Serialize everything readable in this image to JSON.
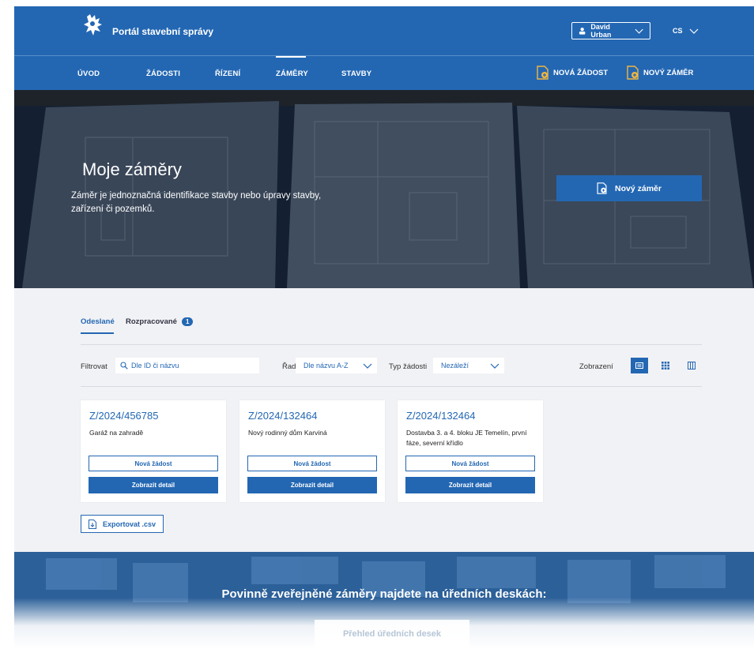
{
  "header": {
    "portal_title": "Portál stavební správy",
    "user_name": "David Urban",
    "language": "CS"
  },
  "nav": {
    "items": [
      "ÚVOD",
      "ŽÁDOSTI",
      "ŘÍZENÍ",
      "ZÁMĚRY",
      "STAVBY"
    ],
    "active": "ZÁMĚRY",
    "new_request": "NOVÁ ŽÁDOST",
    "new_intent": "NOVÝ ZÁMĚR"
  },
  "hero": {
    "title": "Moje záměry",
    "description": "Záměr je jednoznačná identifikace stavby nebo úpravy stavby, zařízení či pozemků.",
    "button": "Nový záměr"
  },
  "tabs": {
    "sent": "Odeslané",
    "drafts": "Rozpracované",
    "drafts_count": "1"
  },
  "filters": {
    "filter_label": "Filtrovat",
    "search_placeholder": "Dle ID či názvu",
    "sort_label": "Řadit",
    "sort_value": "Dle názvu A-Z",
    "type_label": "Typ žádosti",
    "type_value": "Nezáleží",
    "view_label": "Zobrazení"
  },
  "cards": [
    {
      "id": "Z/2024/456785",
      "description": "Garáž na zahradě",
      "btn_new": "Nová žádost",
      "btn_detail": "Zobrazit detail"
    },
    {
      "id": "Z/2024/132464",
      "description": "Nový rodinný dům Karviná",
      "btn_new": "Nová žádost",
      "btn_detail": "Zobrazit detail"
    },
    {
      "id": "Z/2024/132464",
      "description": "Dostavba 3. a 4. bloku JE Temelín, první fáze, severní křídlo",
      "btn_new": "Nová žádost",
      "btn_detail": "Zobrazit detail"
    }
  ],
  "export_label": "Exportovat .csv",
  "bottom": {
    "title": "Povinně zveřejněné záměry najdete na úředních deskách:",
    "button": "Přehled úředních desek"
  },
  "colors": {
    "primary": "#2367b3",
    "page_bg": "#f1f2f5",
    "hero_bg": "#18263a"
  }
}
